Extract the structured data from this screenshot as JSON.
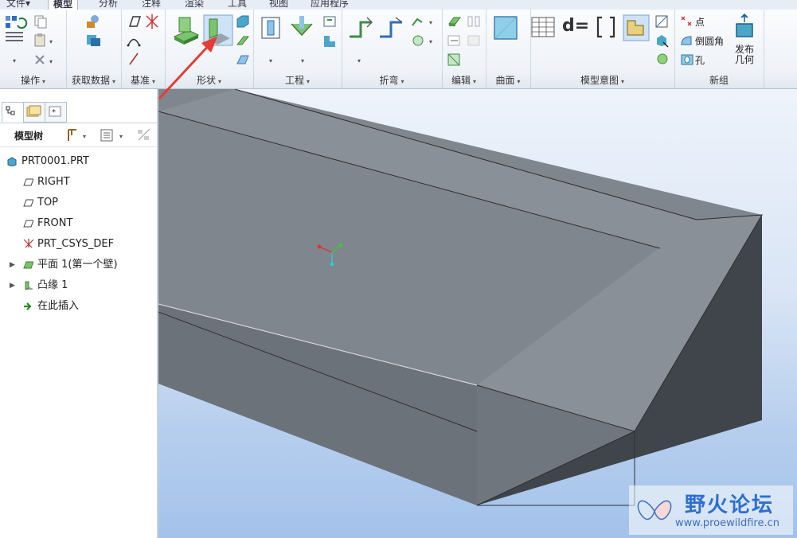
{
  "tabs": [
    {
      "label": "文件",
      "dd": "▾"
    },
    {
      "label": "模型",
      "active": true
    },
    {
      "label": "分析"
    },
    {
      "label": "注释"
    },
    {
      "label": "渲染"
    },
    {
      "label": "工具"
    },
    {
      "label": "视图"
    },
    {
      "label": "应用程序"
    }
  ],
  "ribbon": {
    "items": {
      "point": "点",
      "chamfer": "倒圆角",
      "hole": "孔",
      "publish_line1": "发布",
      "publish_line2": "几何",
      "relations": "d="
    }
  },
  "groups": [
    {
      "label": "操作"
    },
    {
      "label": "获取数据"
    },
    {
      "label": "基准"
    },
    {
      "label": "形状"
    },
    {
      "label": "工程"
    },
    {
      "label": "折弯"
    },
    {
      "label": "编辑"
    },
    {
      "label": "曲面"
    },
    {
      "label": "模型意图"
    },
    {
      "label": "新组"
    }
  ],
  "model_tree": {
    "title": "模型树",
    "items": [
      {
        "label": "PRT0001.PRT",
        "icon": "part-icon"
      },
      {
        "label": "RIGHT",
        "icon": "datum-plane-icon"
      },
      {
        "label": "TOP",
        "icon": "datum-plane-icon"
      },
      {
        "label": "FRONT",
        "icon": "datum-plane-icon"
      },
      {
        "label": "PRT_CSYS_DEF",
        "icon": "csys-icon"
      },
      {
        "label": "平面 1(第一个壁)",
        "icon": "planar-wall-icon",
        "expandable": true
      },
      {
        "label": "凸缘 1",
        "icon": "flange-icon",
        "expandable": true
      },
      {
        "label": "在此插入",
        "icon": "insert-here-icon"
      }
    ]
  },
  "watermark": {
    "title": "野火论坛",
    "url": "www.proewildfire.cn"
  },
  "colors": {
    "accent": "#2d6fd1",
    "model_top": "#7d838b",
    "model_side": "#5a6068",
    "model_dark": "#3d4248",
    "annotation_arrow": "#e53c35"
  }
}
